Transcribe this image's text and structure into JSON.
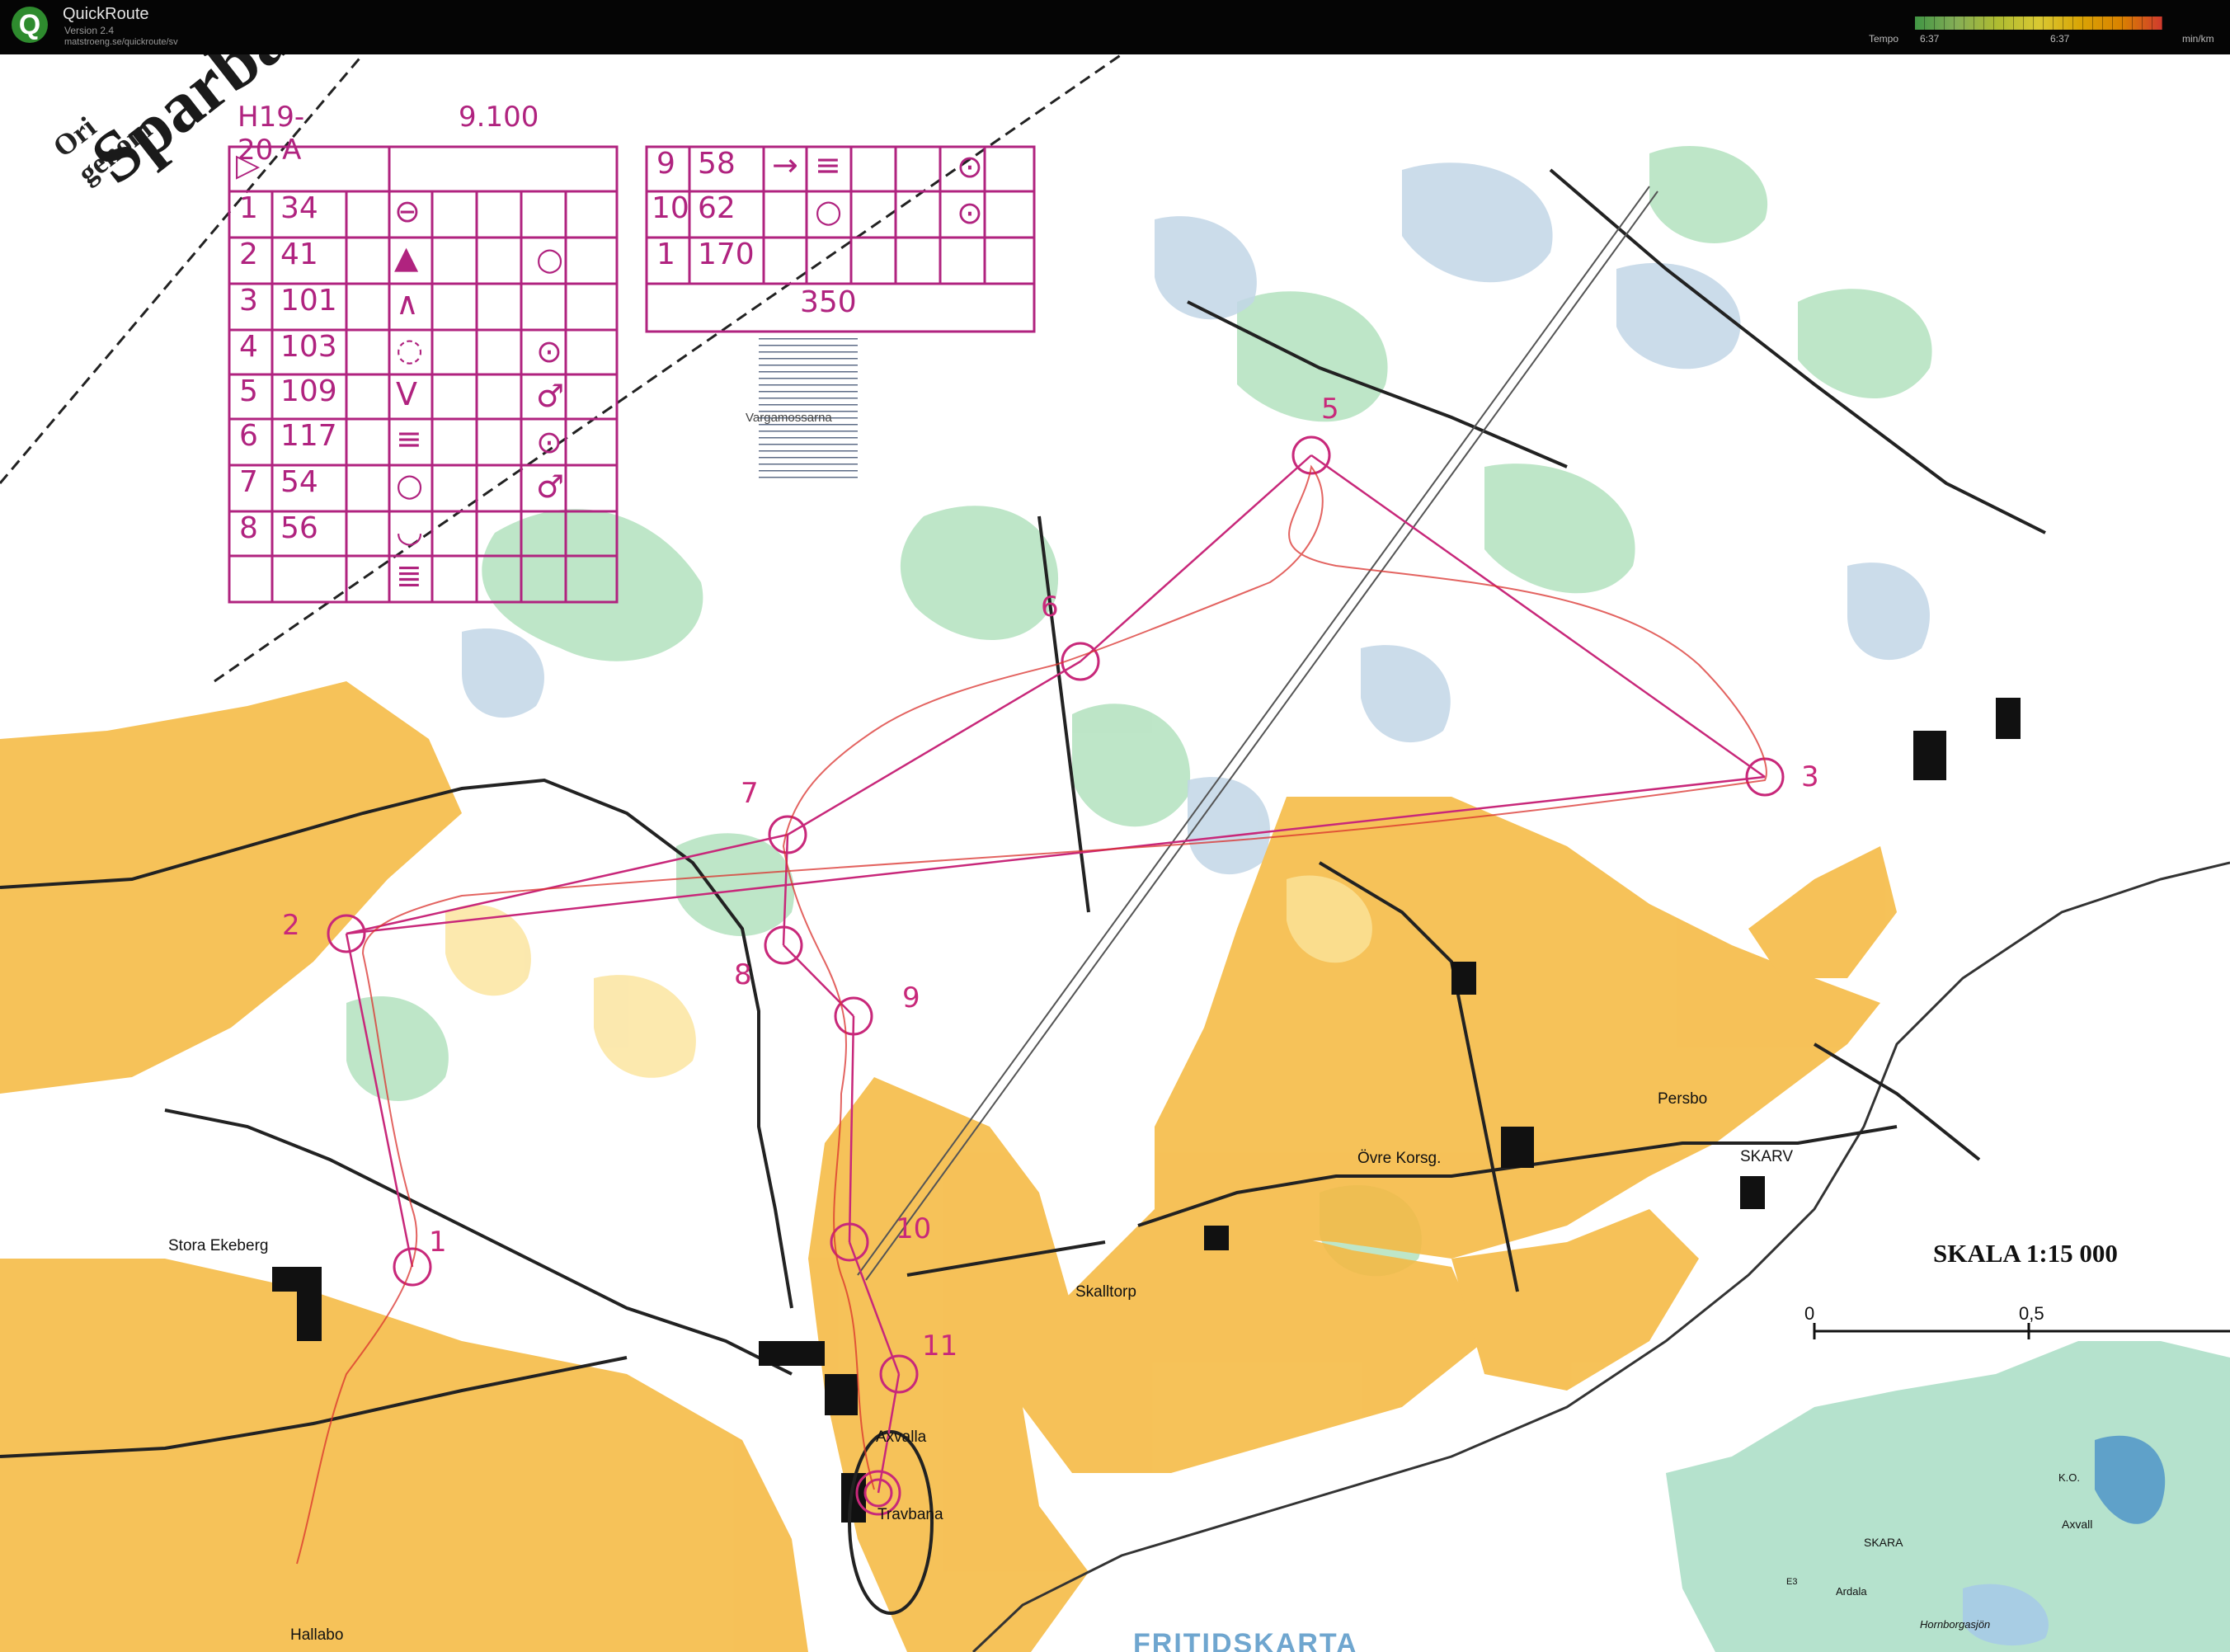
{
  "app": {
    "name": "QuickRoute",
    "version": "Version 2.4",
    "url": "matstroeng.se/quickroute/sv"
  },
  "pace_legend": {
    "label": "Tempo",
    "min": "6:37",
    "max": "6:37",
    "unit": "min/km"
  },
  "map_title": {
    "small1": "Ori",
    "small2": "genom",
    "word": "Sparba"
  },
  "course": {
    "class": "H19-20 A",
    "length": "9.100",
    "start_symbol": "▷",
    "controls": [
      {
        "n": "1",
        "code": "34"
      },
      {
        "n": "2",
        "code": "41"
      },
      {
        "n": "3",
        "code": "101"
      },
      {
        "n": "4",
        "code": "103"
      },
      {
        "n": "5",
        "code": "109"
      },
      {
        "n": "6",
        "code": "117"
      },
      {
        "n": "7",
        "code": "54"
      },
      {
        "n": "8",
        "code": "56"
      },
      {
        "n": "9",
        "code": "58"
      },
      {
        "n": "10",
        "code": "62"
      },
      {
        "n": "1",
        "code": "170"
      }
    ],
    "finish_distance": "350"
  },
  "map_labels": {
    "vargamossarna": "Vargamossarna",
    "stora_ekeberg": "Stora Ekeberg",
    "ovre_korsg": "Övre Korsg.",
    "persbo": "Persbo",
    "skarv": "SKARV",
    "skalltorp": "Skalltorp",
    "axvalla": "Axvalla",
    "travbana": "Travbana",
    "hallabo": "Hallabo",
    "skara": "SKARA",
    "ardala": "Ardala",
    "axvall": "Axvall",
    "ko": "K.O.",
    "hornborgasjon": "Hornborgasjön",
    "e3": "E3",
    "fritidskarta": "FRITIDSKARTA"
  },
  "scale": {
    "text": "SKALA 1:15 000",
    "zero": "0",
    "half": "0,5"
  },
  "control_numbers": [
    "1",
    "2",
    "3",
    "5",
    "6",
    "7",
    "8",
    "9",
    "10",
    "11"
  ],
  "colors": {
    "course": "#c8287a",
    "route": "#d9302c",
    "open_land": "#f5b942",
    "forest_green": "#a8ddb5",
    "marsh_blue": "#c2d6e6",
    "titlebar": "#050505"
  }
}
